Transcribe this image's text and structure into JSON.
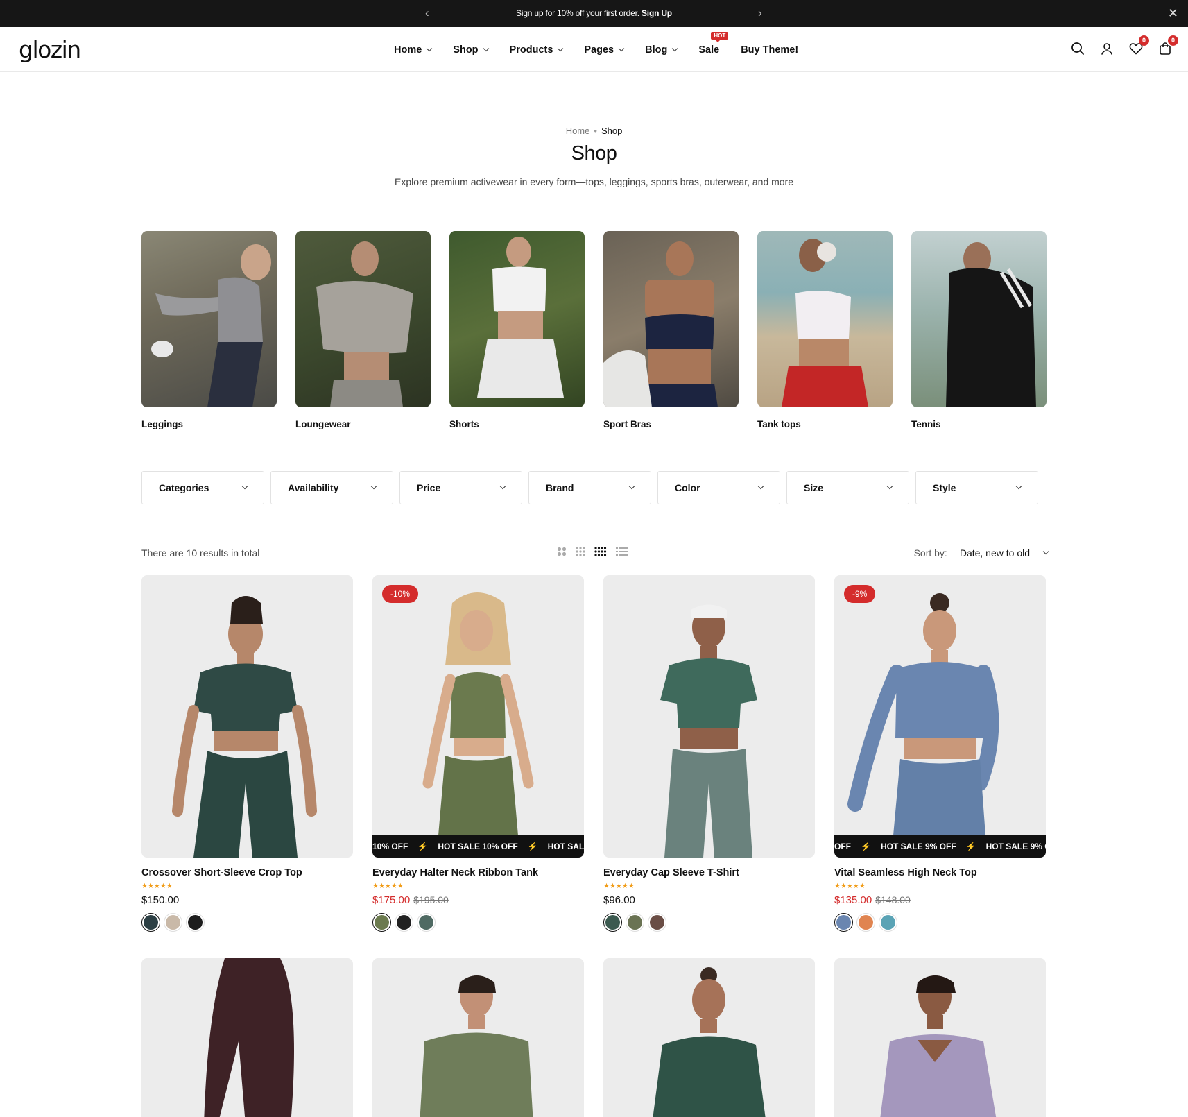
{
  "announcement": {
    "text": "Sign up for 10% off your first order.",
    "link": "Sign Up"
  },
  "header": {
    "logo": "glozin",
    "nav": [
      {
        "label": "Home",
        "dropdown": true
      },
      {
        "label": "Shop",
        "dropdown": true
      },
      {
        "label": "Products",
        "dropdown": true
      },
      {
        "label": "Pages",
        "dropdown": true
      },
      {
        "label": "Blog",
        "dropdown": true
      },
      {
        "label": "Sale",
        "dropdown": false,
        "badge": "HOT"
      },
      {
        "label": "Buy Theme!",
        "dropdown": false
      }
    ],
    "wishlist_count": "0",
    "cart_count": "0",
    "icons": [
      "search-icon",
      "account-icon",
      "wishlist-icon",
      "cart-icon"
    ]
  },
  "breadcrumb": {
    "home": "Home",
    "separator": "•",
    "current": "Shop"
  },
  "page": {
    "title": "Shop",
    "description": "Explore premium activewear in every form—tops, leggings, sports bras, outerwear, and more"
  },
  "categories": [
    "Leggings",
    "Loungewear",
    "Shorts",
    "Sport Bras",
    "Tank tops",
    "Tennis"
  ],
  "filters": [
    "Categories",
    "Availability",
    "Price",
    "Brand",
    "Color",
    "Size",
    "Style"
  ],
  "toolbar": {
    "results": "There are 10 results in total",
    "sort_label": "Sort by:",
    "sort_value": "Date, new to old"
  },
  "products": [
    {
      "title": "Crossover Short-Sleeve Crop Top",
      "price": "$150.00",
      "old_price": "",
      "discount": "",
      "marquee": "",
      "stars": "★★★★★",
      "swatches": [
        "#2c3f44",
        "#c9b9a8",
        "#1d1d1d"
      ]
    },
    {
      "title": "Everyday Halter Neck Ribbon Tank",
      "price": "$175.00",
      "old_price": "$195.00",
      "discount": "-10%",
      "marquee": [
        "10% OFF",
        "⚡",
        "HOT SALE 10% OFF",
        "⚡",
        "HOT SAL"
      ],
      "stars": "★★★★★",
      "swatches": [
        "#6b7a4e",
        "#222222",
        "#4f6a63"
      ]
    },
    {
      "title": "Everyday Cap Sleeve T-Shirt",
      "price": "$96.00",
      "old_price": "",
      "discount": "",
      "marquee": "",
      "stars": "★★★★★",
      "swatches": [
        "#3c5a50",
        "#6a7353",
        "#6a4d45"
      ]
    },
    {
      "title": "Vital Seamless High Neck Top",
      "price": "$135.00",
      "old_price": "$148.00",
      "discount": "-9%",
      "marquee": [
        "OFF",
        "⚡",
        "HOT SALE 9% OFF",
        "⚡",
        "HOT SALE 9% O"
      ],
      "stars": "★★★★★",
      "swatches": [
        "#6a86b0",
        "#e08450",
        "#5aa3b5"
      ]
    }
  ],
  "colors": {
    "accent": "#d42c2c",
    "dark": "#161616",
    "stars": "#f19d1a"
  }
}
